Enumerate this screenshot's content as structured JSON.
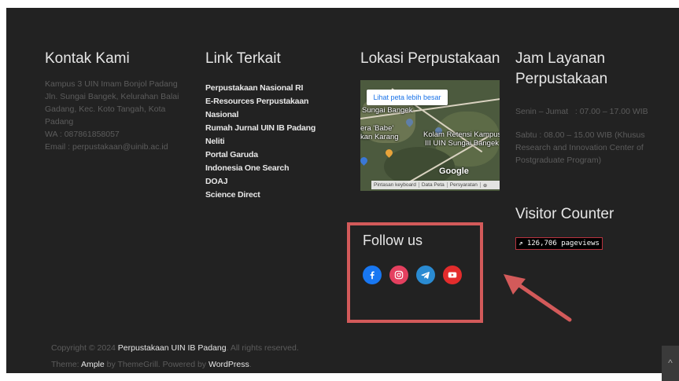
{
  "contact": {
    "title": "Kontak Kami",
    "address_line1": "Kampus 3 UIN Imam Bonjol Padang",
    "address_line2": "Jln. Sungai Bangek, Kelurahan Balai",
    "address_line3": "Gadang, Kec. Koto Tangah, Kota Padang",
    "wa": "WA : 087861858057",
    "email": "Email : perpustakaan@uinib.ac.id"
  },
  "links": {
    "title": "Link Terkait",
    "items": [
      "Perpustakaan Nasional RI",
      "E-Resources Perpustakaan Nasional",
      "Rumah Jurnal UIN IB Padang",
      "Neliti",
      "Portal Garuda",
      "Indonesia One Search",
      "DOAJ",
      "Science Direct"
    ]
  },
  "location": {
    "title": "Lokasi Perpustakaan",
    "map": {
      "button": "Lihat peta lebih besar",
      "label_sungai": "Sungai Bangek",
      "label_era": "era 'Babe'",
      "label_karang": "kan Karang",
      "label_kolam1": "Kolam Retensi Kampus",
      "label_kolam2": "III UIN Sungai Bangek",
      "brand": "Google",
      "footer": [
        "Pintasan keyboard",
        "Data Peta",
        "Persyaratan"
      ]
    }
  },
  "follow": {
    "title": "Follow us",
    "icons": [
      "facebook-icon",
      "instagram-icon",
      "telegram-icon",
      "youtube-icon"
    ],
    "colors": {
      "facebook": "#1877f2",
      "instagram": "#e4405f",
      "telegram": "#2a8bd2",
      "youtube": "#e32c2c"
    }
  },
  "hours": {
    "title_line1": "Jam Layanan",
    "title_line2": "Perpustakaan",
    "weekday": "Senin – Jumat   : 07.00 – 17.00 WIB",
    "saturday_line1": "Sabtu : 08.00 – 15.00 WIB (Khusus",
    "saturday_line2": "Research and Innovation Center of",
    "saturday_line3": "Postgraduate Program)"
  },
  "visitor": {
    "title": "Visitor Counter",
    "count": "126,706 pageviews"
  },
  "footer": {
    "copyright_prefix": "Copyright © 2024 ",
    "copyright_link": "Perpustakaan UIN IB Padang",
    "copyright_suffix": ". All rights reserved.",
    "theme_prefix": "Theme: ",
    "theme_link": "Ample",
    "theme_mid": " by ThemeGrill. Powered by ",
    "powered_link": "WordPress",
    "theme_suffix": "."
  },
  "colors": {
    "background": "#222222",
    "highlight_border": "#d35a5a",
    "arrow": "#d35a5a"
  }
}
